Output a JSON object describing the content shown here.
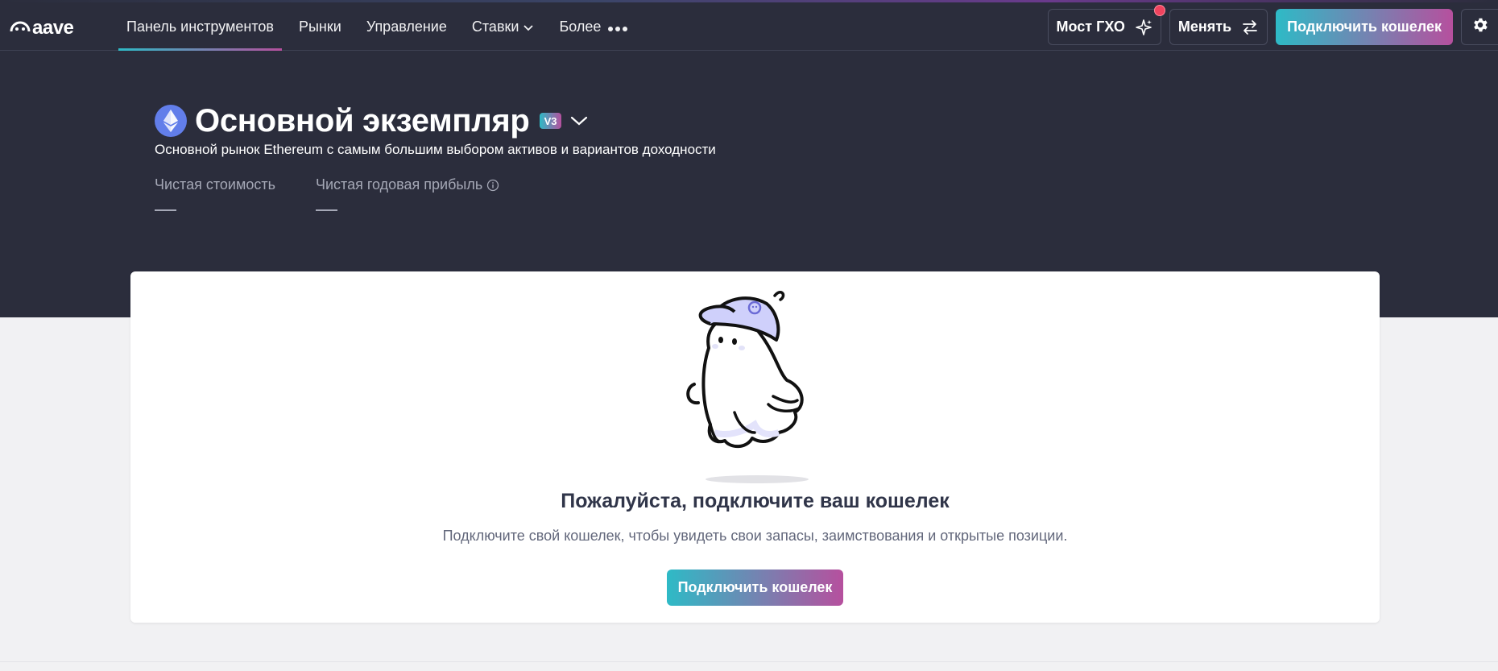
{
  "brand": {
    "logo_text": "aave"
  },
  "nav": {
    "items": [
      {
        "label": "Панель инструментов",
        "active": true
      },
      {
        "label": "Рынки"
      },
      {
        "label": "Управление"
      },
      {
        "label": "Ставки"
      },
      {
        "label": "Более"
      }
    ]
  },
  "header_actions": {
    "bridge_label": "Мост ГХО",
    "swap_label": "Менять",
    "connect_label": "Подключить кошелек"
  },
  "market": {
    "title": "Основной экземпляр",
    "version_badge": "V3",
    "description": "Основной рынок Ethereum с самым большим выбором активов и вариантов доходности"
  },
  "stats": {
    "net_worth_label": "Чистая стоимость",
    "net_worth_value": "—",
    "net_apy_label": "Чистая годовая прибыль",
    "net_apy_value": "—"
  },
  "connect_card": {
    "title": "Пожалуйста, подключите ваш кошелек",
    "subtitle": "Подключите свой кошелек, чтобы увидеть свои запасы, заимствования и открытые позиции.",
    "button_label": "Подключить кошелек"
  },
  "colors": {
    "header_bg": "#2b2d3c",
    "gradient_start": "#2ebac6",
    "gradient_end": "#b6509e",
    "page_bg": "#f1f1f3",
    "ethereum": "#627eea"
  },
  "icons": [
    "aave-logo-icon",
    "chevron-down-icon",
    "more-dots-icon",
    "sparkle-icon",
    "swap-arrows-icon",
    "gear-icon",
    "ethereum-icon",
    "info-icon",
    "ghost-illustration"
  ]
}
